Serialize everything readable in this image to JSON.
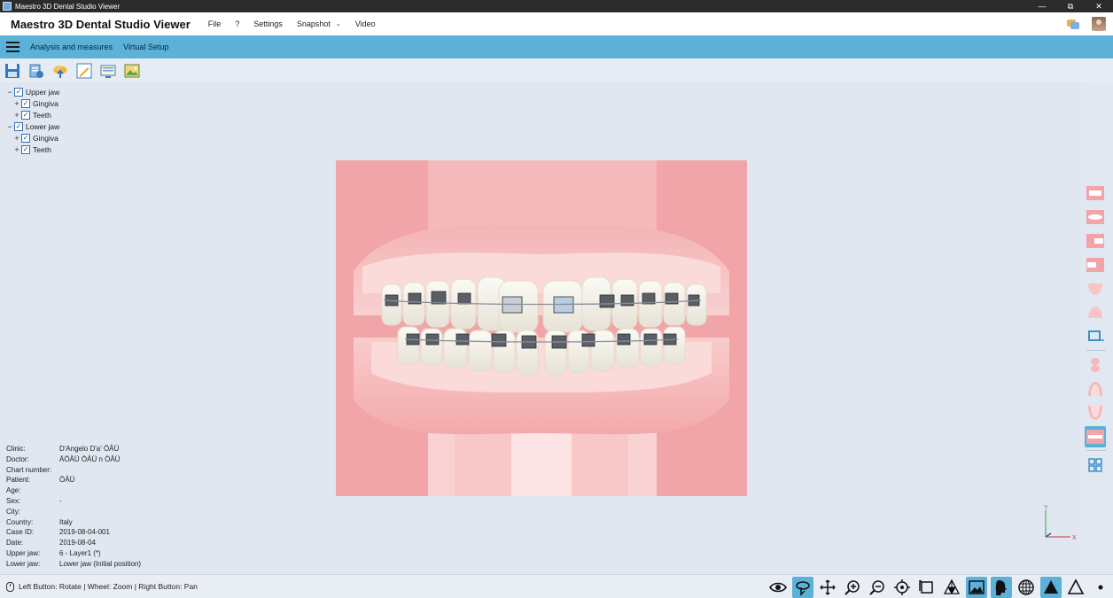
{
  "window": {
    "title": "Maestro 3D Dental Studio Viewer",
    "minimize": "—",
    "maximize": "⧉",
    "close": "✕"
  },
  "header": {
    "app_name": "Maestro 3D Dental Studio Viewer",
    "menu": [
      {
        "label": "File"
      },
      {
        "label": "?"
      },
      {
        "label": "Settings"
      },
      {
        "label": "Snapshot"
      },
      {
        "label": "Video"
      }
    ]
  },
  "ribbon": {
    "tabs": [
      {
        "label": "Analysis and measures"
      },
      {
        "label": "Virtual Setup"
      }
    ]
  },
  "toolbar": {
    "icons": [
      "save-icon",
      "export-icon",
      "cloud-upload-icon",
      "pencil-icon",
      "monitor-icon",
      "image-icon"
    ]
  },
  "tree": {
    "upper": {
      "label": "Upper jaw",
      "expander": "−",
      "check": "✓",
      "children": [
        {
          "label": "Gingiva",
          "expander": "+",
          "check": "✓"
        },
        {
          "label": "Teeth",
          "expander": "+",
          "check": "✓"
        }
      ]
    },
    "lower": {
      "label": "Lower jaw",
      "expander": "−",
      "check": "✓",
      "children": [
        {
          "label": "Gingiva",
          "expander": "+",
          "check": "✓"
        },
        {
          "label": "Teeth",
          "expander": "+",
          "check": "✓"
        }
      ]
    }
  },
  "info": {
    "rows": [
      {
        "key": "Clinic:",
        "value": "D'Angelo D'a' ÖÂÜ"
      },
      {
        "key": "Doctor:",
        "value": "ÄÖÂÜ ÖÂÜ n ÖÂÜ"
      },
      {
        "key": "Chart number:",
        "value": ""
      },
      {
        "key": "Patient:",
        "value": "ÖÂÜ"
      },
      {
        "key": "Age:",
        "value": ""
      },
      {
        "key": "Sex:",
        "value": "-"
      },
      {
        "key": "City:",
        "value": ""
      },
      {
        "key": "Country:",
        "value": "Italy"
      },
      {
        "key": "Case ID:",
        "value": "2019-08-04-001"
      },
      {
        "key": "Date:",
        "value": "2019-08-04"
      },
      {
        "key": "Upper jaw:",
        "value": "6 - Layer1 (*)"
      },
      {
        "key": "Lower jaw:",
        "value": "Lower jaw (Initial position)"
      }
    ]
  },
  "axes": {
    "y": "Y",
    "x": "X"
  },
  "status": {
    "text": "Left Button: Rotate | Wheel: Zoom | Right Button: Pan"
  },
  "colors": {
    "accent": "#5bb1d8",
    "gingiva": "#f2a5a8",
    "teeth": "#f6f4ec"
  }
}
